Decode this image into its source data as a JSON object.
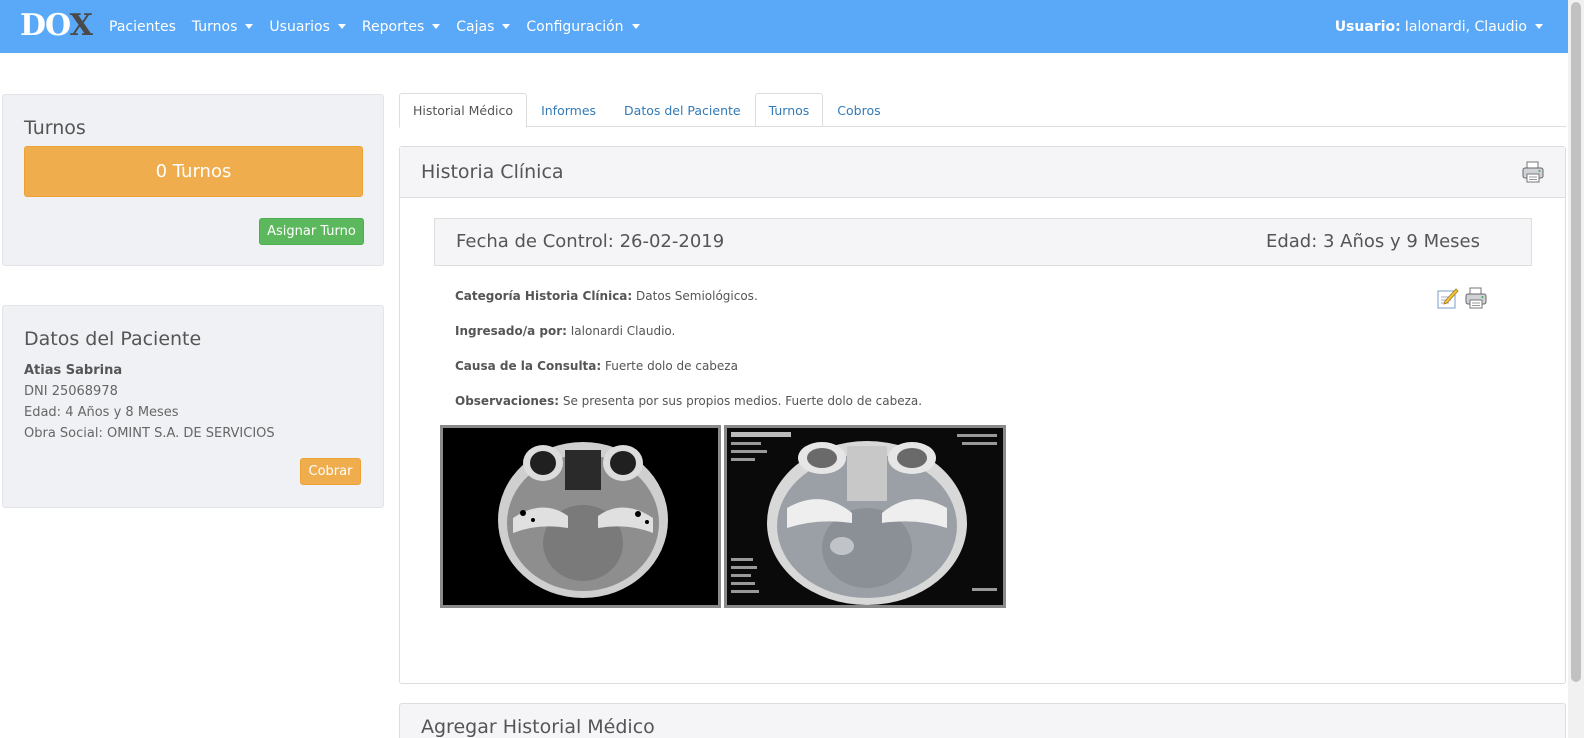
{
  "brand": {
    "main": "DO",
    "accent": "X"
  },
  "nav": {
    "items": [
      {
        "label": "Pacientes",
        "dropdown": false
      },
      {
        "label": "Turnos",
        "dropdown": true
      },
      {
        "label": "Usuarios",
        "dropdown": true
      },
      {
        "label": "Reportes",
        "dropdown": true
      },
      {
        "label": "Cajas",
        "dropdown": true
      },
      {
        "label": "Configuración",
        "dropdown": true
      }
    ],
    "user_label": "Usuario:",
    "user_name": "Ialonardi, Claudio"
  },
  "turnos_panel": {
    "title": "Turnos",
    "count_label": "0 Turnos",
    "assign_button": "Asignar Turno"
  },
  "patient_panel": {
    "title": "Datos del Paciente",
    "name": "Atias Sabrina",
    "dni": "DNI 25068978",
    "age": "Edad: 4 Años y 8 Meses",
    "insurance": "Obra Social: OMINT S.A. DE SERVICIOS",
    "charge_button": "Cobrar"
  },
  "tabs": [
    {
      "label": "Historial Médico",
      "active": true
    },
    {
      "label": "Informes",
      "active": false
    },
    {
      "label": "Datos del Paciente",
      "active": false
    },
    {
      "label": "Turnos",
      "active": false
    },
    {
      "label": "Cobros",
      "active": false
    }
  ],
  "history": {
    "title": "Historia Clínica",
    "record": {
      "date_label": "Fecha de Control: 26-02-2019",
      "age_label": "Edad: 3 Años y 9 Meses",
      "category_key": "Categoría Historia Clínica:",
      "category_value": "Datos Semiológicos.",
      "entered_key": "Ingresado/a por:",
      "entered_value": "Ialonardi Claudio.",
      "cause_key": "Causa de la Consulta:",
      "cause_value": "Fuerte dolo de cabeza",
      "obs_key": "Observaciones:",
      "obs_value": "Se presenta por sus propios medios. Fuerte dolo de cabeza."
    }
  },
  "add_history_title": "Agregar Historial Médico",
  "icons": [
    "printer-icon",
    "edit-note-icon",
    "caret-down-icon"
  ],
  "colors": {
    "navbar": "#5aa9f8",
    "warning": "#f0ad4e",
    "success": "#5cb85c",
    "link": "#337ab7",
    "panel_bg": "#f0f1f4"
  }
}
